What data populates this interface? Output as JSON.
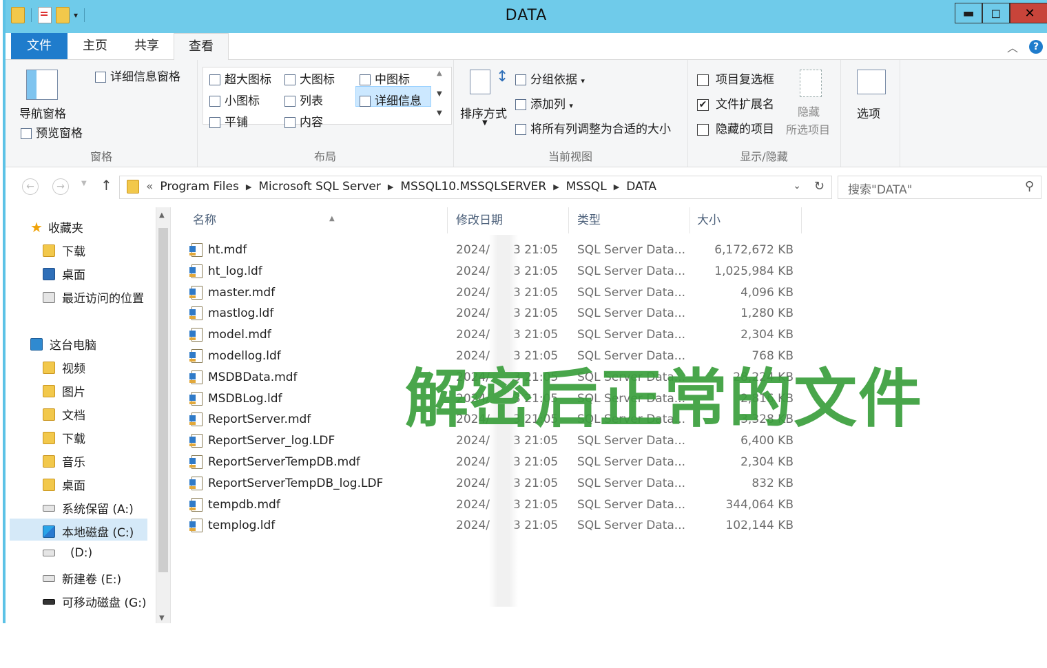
{
  "window": {
    "title": "DATA"
  },
  "tabs": {
    "file": "文件",
    "home": "主页",
    "share": "共享",
    "view": "查看"
  },
  "ribbon": {
    "panes": {
      "nav_pane": "导航窗格",
      "preview_pane": "预览窗格",
      "details_pane": "详细信息窗格",
      "label": "窗格"
    },
    "layout": {
      "xl_icons": "超大图标",
      "large_icons": "大图标",
      "medium_icons": "中图标",
      "small_icons": "小图标",
      "list": "列表",
      "details": "详细信息",
      "tiles": "平铺",
      "content": "内容",
      "label": "布局"
    },
    "current_view": {
      "sort_by": "排序方式",
      "group_by": "分组依据",
      "add_column": "添加列",
      "fit_columns": "将所有列调整为合适的大小",
      "label": "当前视图"
    },
    "show_hide": {
      "item_checkboxes": "项目复选框",
      "file_extensions": "文件扩展名",
      "hidden_items": "隐藏的项目",
      "hide": "隐藏",
      "selected_items": "所选项目",
      "label": "显示/隐藏",
      "file_extensions_checked": true
    },
    "options": "选项"
  },
  "address": {
    "breadcrumbs": [
      "Program Files",
      "Microsoft SQL Server",
      "MSSQL10.MSSQLSERVER",
      "MSSQL",
      "DATA"
    ],
    "search_placeholder": "搜索\"DATA\""
  },
  "nav": {
    "favorites": "收藏夹",
    "downloads": "下载",
    "desktop": "桌面",
    "recent": "最近访问的位置",
    "this_pc": "这台电脑",
    "videos": "视频",
    "pictures": "图片",
    "documents": "文档",
    "downloads2": "下载",
    "music": "音乐",
    "desktop2": "桌面",
    "drive_a": "系统保留 (A:)",
    "drive_c": "本地磁盘 (C:)",
    "drive_d": "(D:)",
    "drive_e": "新建卷 (E:)",
    "drive_g": "可移动磁盘 (G:)"
  },
  "columns": {
    "name": "名称",
    "modified": "修改日期",
    "type": "类型",
    "size": "大小"
  },
  "files": [
    {
      "name": "ht.mdf",
      "date": "2024/",
      "time": "3 21:05",
      "type": "SQL Server Data...",
      "size": "6,172,672 KB"
    },
    {
      "name": "ht_log.ldf",
      "date": "2024/",
      "time": "3 21:05",
      "type": "SQL Server Data...",
      "size": "1,025,984 KB"
    },
    {
      "name": "master.mdf",
      "date": "2024/",
      "time": "3 21:05",
      "type": "SQL Server Data...",
      "size": "4,096 KB"
    },
    {
      "name": "mastlog.ldf",
      "date": "2024/",
      "time": "3 21:05",
      "type": "SQL Server Data...",
      "size": "1,280 KB"
    },
    {
      "name": "model.mdf",
      "date": "2024/",
      "time": "3 21:05",
      "type": "SQL Server Data...",
      "size": "2,304 KB"
    },
    {
      "name": "modellog.ldf",
      "date": "2024/",
      "time": "3 21:05",
      "type": "SQL Server Data...",
      "size": "768 KB"
    },
    {
      "name": "MSDBData.mdf",
      "date": "2024/",
      "time": "3 21:05",
      "type": "SQL Server Data...",
      "size": "28,224 KB"
    },
    {
      "name": "MSDBLog.ldf",
      "date": "2024/",
      "time": "3 21:05",
      "type": "SQL Server Data...",
      "size": "2,816 KB"
    },
    {
      "name": "ReportServer.mdf",
      "date": "2024/",
      "time": "3 21:05",
      "type": "SQL Server Data...",
      "size": "3,328 KB"
    },
    {
      "name": "ReportServer_log.LDF",
      "date": "2024/",
      "time": "3 21:05",
      "type": "SQL Server Data...",
      "size": "6,400 KB"
    },
    {
      "name": "ReportServerTempDB.mdf",
      "date": "2024/",
      "time": "3 21:05",
      "type": "SQL Server Data...",
      "size": "2,304 KB"
    },
    {
      "name": "ReportServerTempDB_log.LDF",
      "date": "2024/",
      "time": "3 21:05",
      "type": "SQL Server Data...",
      "size": "832 KB"
    },
    {
      "name": "tempdb.mdf",
      "date": "2024/",
      "time": "3 21:05",
      "type": "SQL Server Data...",
      "size": "344,064 KB"
    },
    {
      "name": "templog.ldf",
      "date": "2024/",
      "time": "3 21:05",
      "type": "SQL Server Data...",
      "size": "102,144 KB"
    }
  ],
  "overlay_caption": "解密后正常的文件",
  "colors": {
    "titlebar": "#6fcbea",
    "file_tab": "#1f7ccc",
    "overlay_text": "#3a9f3c"
  }
}
